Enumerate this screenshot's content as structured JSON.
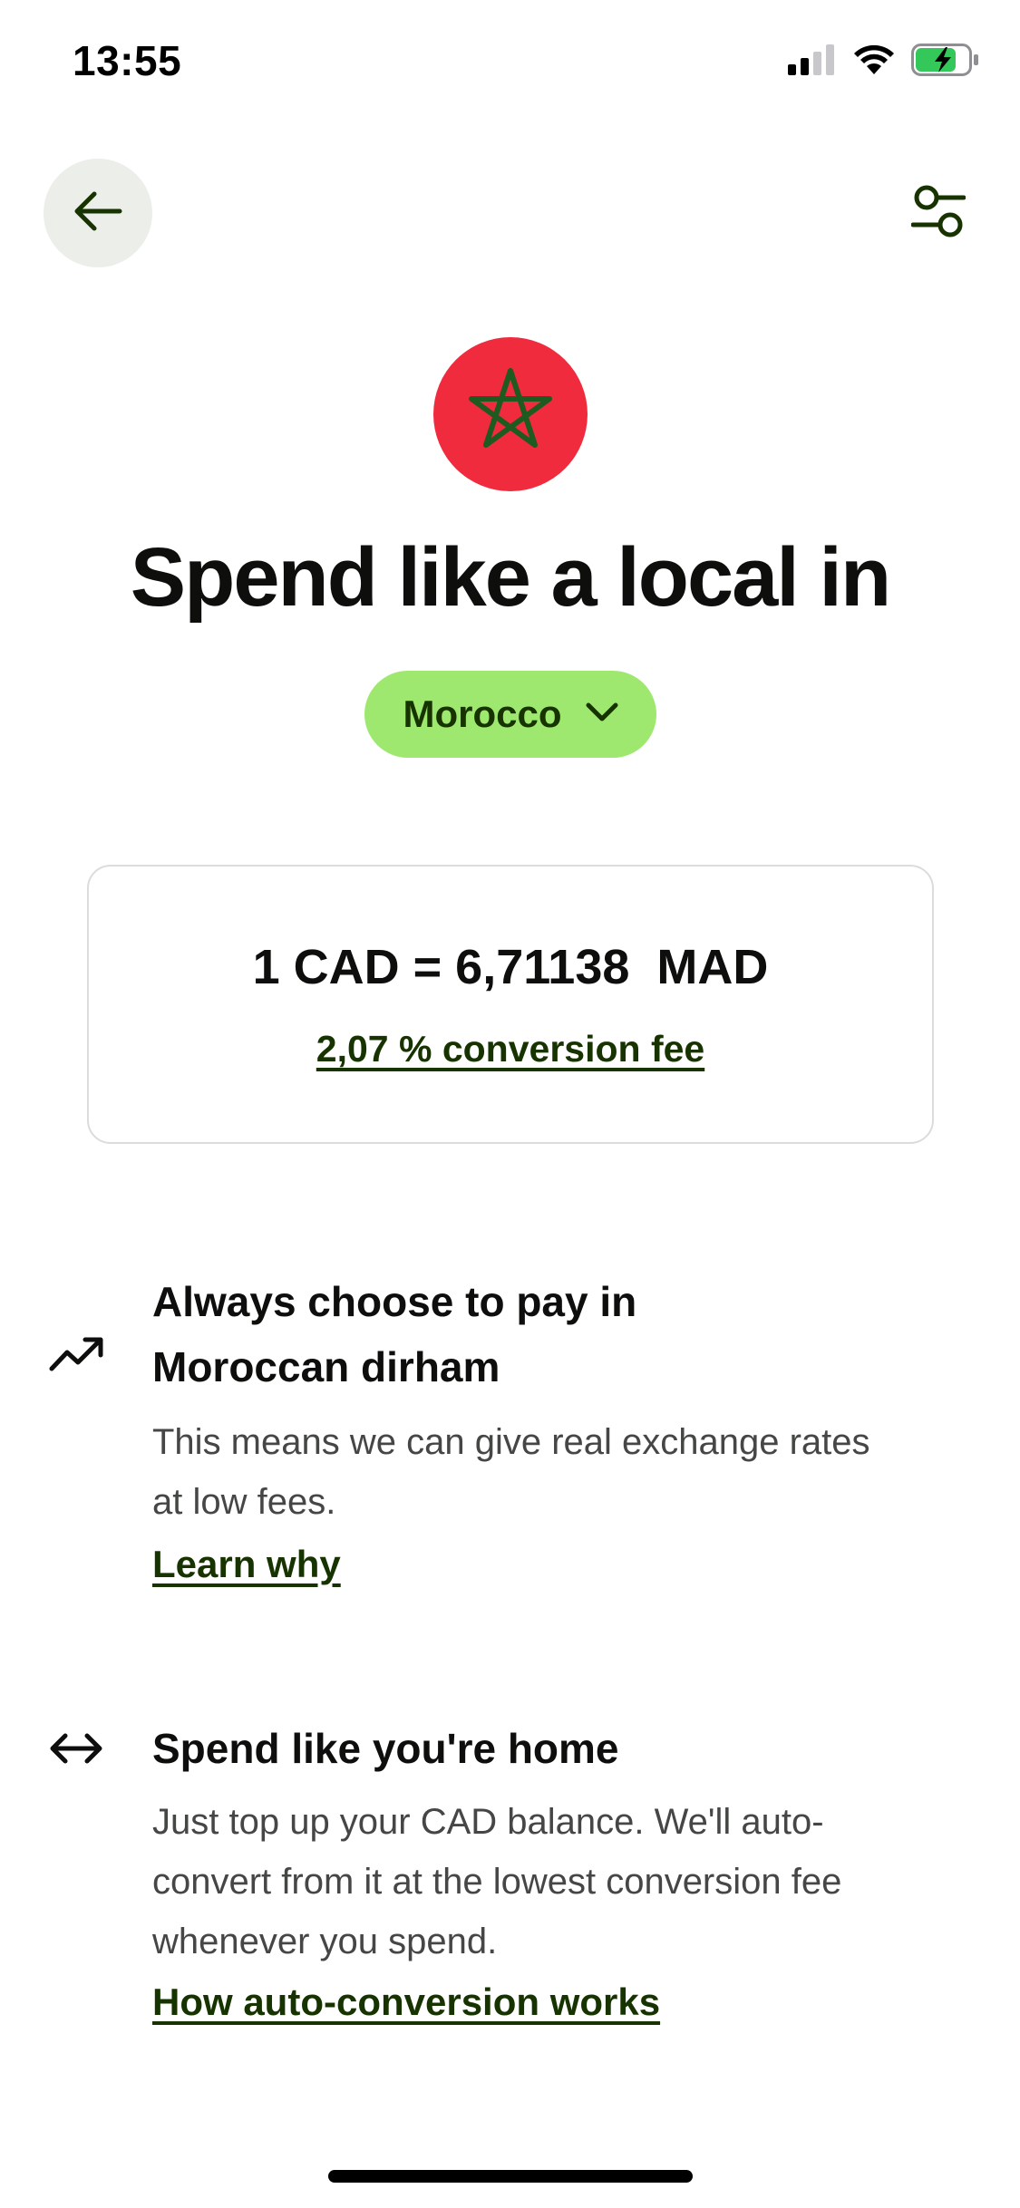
{
  "status_bar": {
    "time": "13:55",
    "icons": [
      "cellular-signal-icon",
      "wifi-icon",
      "battery-charging-icon"
    ],
    "battery_color": "#34c759"
  },
  "header": {
    "back_icon": "arrow-left-icon",
    "filter_icon": "sliders-icon"
  },
  "flag": {
    "icon": "morocco-flag-icon",
    "background_color": "#ef2b3d",
    "star_color": "#1f5a20"
  },
  "headline": "Spend like a local in",
  "country_selector": {
    "label": "Morocco",
    "icon": "chevron-down-icon",
    "background_color": "#9fe870"
  },
  "rate_card": {
    "rate": "1 CAD = 6,71138  MAD",
    "fee_link": "2,07 % conversion fee"
  },
  "features": [
    {
      "icon": "trending-up-icon",
      "title_line1": "Always choose to pay in",
      "title_line2": "Moroccan dirham",
      "desc_line1": "This means we can give real exchange rates",
      "desc_line2": "at low fees.",
      "link": "Learn why"
    },
    {
      "icon": "arrows-left-right-icon",
      "title_line1": "Spend like you're home",
      "desc_line1": "Just top up your CAD balance. We'll auto-",
      "desc_line2": "convert from it at the lowest conversion fee",
      "desc_line3": "whenever you spend.",
      "link": "How auto-conversion works"
    }
  ],
  "colors": {
    "accent_green": "#9fe870",
    "dark_green": "#163300",
    "text_primary": "#0e0f0c",
    "text_secondary": "#454745"
  }
}
